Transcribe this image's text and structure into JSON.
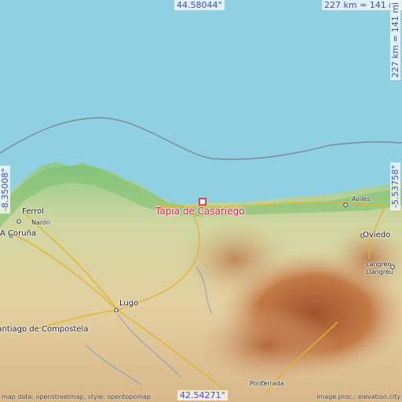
{
  "coords": {
    "top_lat": "44.58044°",
    "bottom_lat": "42.54271°",
    "left_lon": "-8.35008°",
    "right_lon": "-5.53758°",
    "scale_top": "227 km = 141 mi",
    "scale_right": "227 km = 141 mi"
  },
  "highlight": {
    "name": "Tapia de Casariego"
  },
  "cities": {
    "ferrol": "Ferrol",
    "naron": "Narón",
    "a_coruna": "A Coruña",
    "lugo": "Lugo",
    "santiago": "Santiago de Compostela",
    "aviles": "Avilés",
    "oviedo": "Oviedo",
    "langreo": "Langreo",
    "llangreu": "Llangréu",
    "ponferrada": "Ponferrada"
  },
  "attribution": {
    "left": "map data: openstreetmap, style: opentopomap",
    "right": "image proc.: elevation.city"
  },
  "colors": {
    "sea": "#8fd0e3",
    "coord_text": "#3c4bd0",
    "highlight": "#e0203a"
  }
}
